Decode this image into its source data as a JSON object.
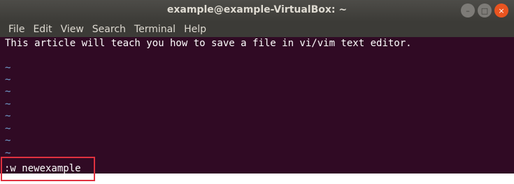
{
  "window": {
    "title": "example@example-VirtualBox: ~",
    "buttons": {
      "minimize": "–",
      "maximize": "□",
      "close": "×"
    }
  },
  "menu": [
    "File",
    "Edit",
    "View",
    "Search",
    "Terminal",
    "Help"
  ],
  "editor": {
    "first_line": "This article will teach you how to save a file in vi/vim text editor.",
    "tilde": "~",
    "command": ":w newexample"
  },
  "colors": {
    "terminal_bg": "#300a24",
    "tilde": "#729fcf",
    "highlight_box": "#e0313f"
  }
}
